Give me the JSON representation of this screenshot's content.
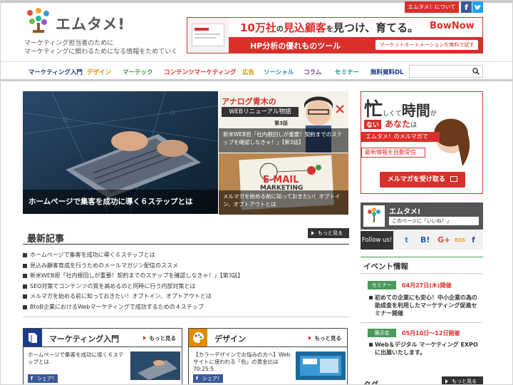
{
  "header": {
    "logo_text": "エムタメ!",
    "tagline_1": "マーケティング担当者のために",
    "tagline_2": "マーケティングに関わるためになる情報をためていく",
    "about_label": "エムタメ！について",
    "fb_glyph": "f"
  },
  "ad_banner": {
    "main_1": "10万社",
    "main_2": "の",
    "main_3": "見込顧客",
    "main_4": "を",
    "main_5": "見つけ、育てる。",
    "brand": "BowNow",
    "sub": "HP分析の優れものツール",
    "cta": "マーケットオートメーションを無料で試す"
  },
  "nav": {
    "items": [
      {
        "label": "マーケティング入門",
        "color": "#1a3a8c"
      },
      {
        "label": "デザイン",
        "color": "#e08b00"
      },
      {
        "label": "マーテック",
        "color": "#3a9a3a"
      },
      {
        "label": "コンテンツマーケティング",
        "color": "#d9302c"
      },
      {
        "label": "広告",
        "color": "#c89a00"
      },
      {
        "label": "ソーシャル",
        "color": "#2a8ab8"
      },
      {
        "label": "コラム",
        "color": "#7a4a9a"
      },
      {
        "label": "セミナー",
        "color": "#1a8a8a"
      },
      {
        "label": "無料資料DL",
        "color": "#1a3a8c"
      }
    ],
    "search_placeholder": ""
  },
  "hero": {
    "main_caption": "ホームページで集客を成功に導く６ステップとは",
    "side_1_banner": "アナログ青木の",
    "side_1_banner_2": "WEBリニューアル物語",
    "side_1_episode": "第3話",
    "side_1_caption": "新米WEB担「社内根回しが重要！契約までのステップを確認しなきゃ！」【第3話】",
    "side_2_caption": "メルマガを始める前に知っておきたい！オプトイン、オプトアウトとは",
    "side_2_word": "E-MAIL",
    "side_2_word_2": "MARKETING"
  },
  "latest": {
    "title": "最新記事",
    "more": "もっと見る",
    "items": [
      "ホームページで集客を成功に導く６ステップとは",
      "見込み顧客育成を行うためのメールマガジン配信のススメ",
      "新米WEB担「社内根回しが重要！契約までのステップを確認しなきゃ！」【第3話】",
      "SEO対策でコンテンツの質を高めるのと同時に行う内部対策とは",
      "メルマガを始める前に知っておきたい！オプトイン、オプトアウトとは",
      "BtoB企業におけるWebマーケティングで成功するための４ステップ"
    ]
  },
  "categories": [
    {
      "title": "マーケティング入門",
      "more": "もっと見る",
      "text": "ホームページで集客を成功に導く６ステップとは",
      "share": "シェア！",
      "color": "#1a3a8c"
    },
    {
      "title": "デザイン",
      "more": "もっと見る",
      "text": "【カラーデザインでお悩みの方へ】Webサイトに使われる「色」の黄金比は70:25:5",
      "share": "シェア！",
      "color": "#e08b00"
    }
  ],
  "sidebar": {
    "ad_line_1": "忙",
    "ad_line_1b": "しくて",
    "ad_line_1c": "時間",
    "ad_line_1d": "が",
    "ad_line_2": "ない",
    "ad_line_2b": "あなた",
    "ad_line_2c": "は",
    "ad_sub_1": "エムタメ！のメルマガで",
    "ad_sub_2": "最新情報を自動受信",
    "ad_button": "メルマガを受け取る",
    "fb_name": "エムタメ!",
    "fb_like": "このページに「いいね！」",
    "follow_label": "Follow us!",
    "follow_icons": [
      "t",
      "B!",
      "G+",
      "RSS",
      "f"
    ],
    "events_title": "イベント情報",
    "events": [
      {
        "tag": "セミナー",
        "date": "04月27日(木)開催",
        "text": "初めての企業にも安心！中小企業の為の助成金を利用したマーケティング促進セミナー開催"
      },
      {
        "tag": "展示会",
        "date": "05月10日～12日開催",
        "text": "Web＆デジタル マーケティング EXPO に出展いたします。"
      }
    ],
    "tags_title": "タグ",
    "tags_more": "もっと見る"
  },
  "colors": {
    "accent": "#d9302c",
    "dark": "#333333",
    "event_green": "#4a9b5b"
  }
}
